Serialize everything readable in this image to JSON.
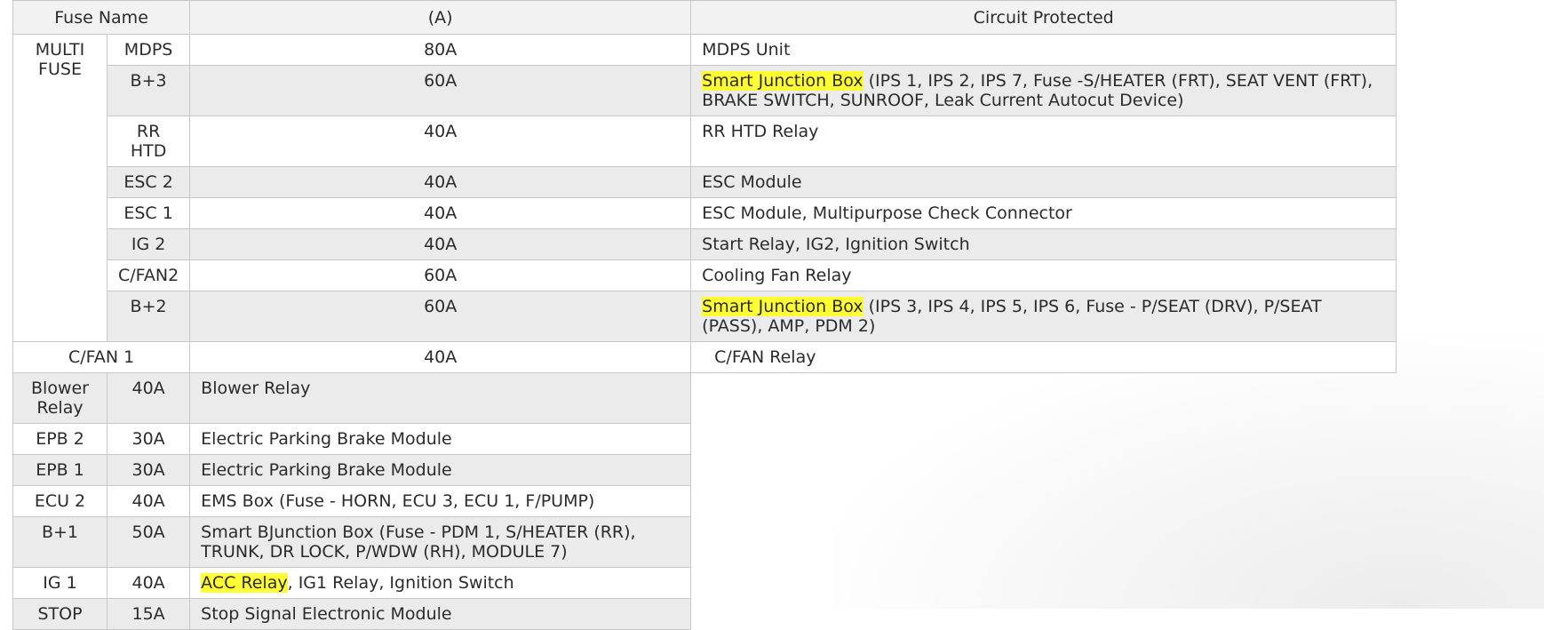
{
  "header": {
    "fuse_name": "Fuse Name",
    "ampere": "(A)",
    "circuit": "Circuit Protected"
  },
  "multi_fuse": {
    "group_label": "MULTI FUSE",
    "rows": [
      {
        "name": "MDPS",
        "amp": "80A",
        "highlight": "",
        "circuit": "MDPS Unit"
      },
      {
        "name": "B+3",
        "amp": "60A",
        "highlight": "Smart Junction Box",
        "circuit": " (IPS 1, IPS 2, IPS 7, Fuse -S/HEATER (FRT), SEAT VENT (FRT), BRAKE SWITCH, SUNROOF, Leak Current Autocut Device)"
      },
      {
        "name": "RR HTD",
        "amp": "40A",
        "highlight": "",
        "circuit": "RR HTD Relay"
      },
      {
        "name": "ESC 2",
        "amp": "40A",
        "highlight": "",
        "circuit": "ESC Module"
      },
      {
        "name": "ESC 1",
        "amp": "40A",
        "highlight": "",
        "circuit": "ESC Module, Multipurpose Check Connector"
      },
      {
        "name": "IG 2",
        "amp": "40A",
        "highlight": "",
        "circuit": "Start Relay, IG2, Ignition Switch"
      },
      {
        "name": "C/FAN2",
        "amp": "60A",
        "highlight": "",
        "circuit": "Cooling Fan Relay"
      },
      {
        "name": "B+2",
        "amp": "60A",
        "highlight": "Smart Junction Box",
        "circuit": " (IPS 3, IPS 4, IPS 5, IPS 6, Fuse - P/SEAT (DRV), P/SEAT (PASS), AMP, PDM 2)"
      }
    ]
  },
  "cfan1": {
    "name": "C/FAN 1",
    "amp": "40A",
    "circuit": "C/FAN Relay"
  },
  "lower_rows": [
    {
      "name": "Blower Relay",
      "amp": "40A",
      "highlight": "",
      "circuit": "Blower Relay"
    },
    {
      "name": "EPB 2",
      "amp": "30A",
      "highlight": "",
      "circuit": "Electric Parking Brake Module"
    },
    {
      "name": "EPB 1",
      "amp": "30A",
      "highlight": "",
      "circuit": "Electric Parking Brake Module"
    },
    {
      "name": "ECU 2",
      "amp": "40A",
      "highlight": "",
      "circuit": "EMS Box (Fuse - HORN, ECU 3, ECU 1, F/PUMP)"
    },
    {
      "name": "B+1",
      "amp": "50A",
      "highlight": "",
      "circuit": "Smart BJunction Box (Fuse - PDM 1, S/HEATER (RR), TRUNK, DR LOCK, P/WDW (RH), MODULE 7)"
    },
    {
      "name": "IG 1",
      "amp": "40A",
      "highlight": "ACC Relay",
      "circuit": ", IG1 Relay, Ignition Switch"
    },
    {
      "name": "STOP",
      "amp": "15A",
      "highlight": "",
      "circuit": "Stop Signal Electronic Module"
    }
  ],
  "colors": {
    "highlight": "#ffff33",
    "row_shade": "#ebebec",
    "border": "#c8c8c8"
  }
}
